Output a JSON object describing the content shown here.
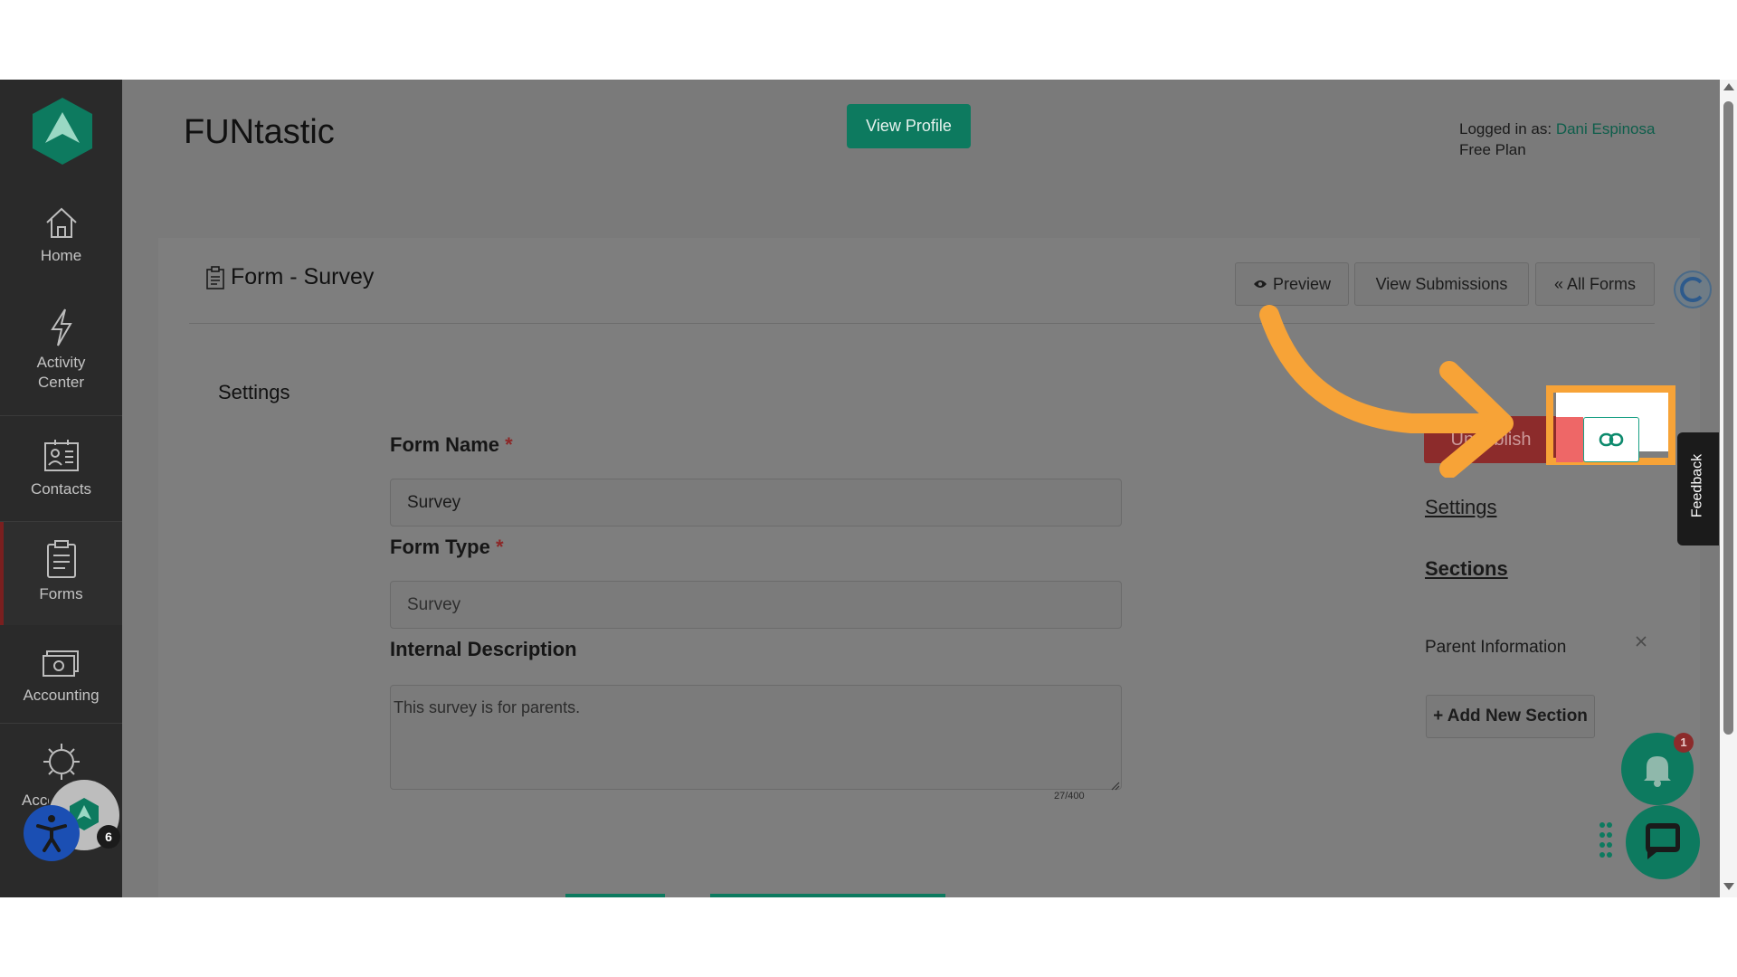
{
  "header": {
    "org_name": "FUNtastic",
    "view_profile_label": "View Profile",
    "logged_in_prefix": "Logged in as:",
    "user_name": "Dani Espinosa",
    "plan": "Free Plan"
  },
  "sidebar": {
    "items": [
      {
        "label": "Home",
        "icon": "home-icon"
      },
      {
        "label": "Activity Center",
        "icon": "lightning-icon"
      },
      {
        "label": "Contacts",
        "icon": "contacts-icon"
      },
      {
        "label": "Forms",
        "icon": "forms-icon"
      },
      {
        "label": "Accounting",
        "icon": "accounting-icon"
      },
      {
        "label": "Account Settings",
        "label_visible": "Acc S",
        "icon": "gear-icon"
      }
    ],
    "badge_count": "6"
  },
  "form_header": {
    "title": "Form - Survey",
    "preview_label": "Preview",
    "view_submissions_label": "View Submissions",
    "all_forms_label": "« All Forms"
  },
  "settings_heading": "Settings",
  "form_fields": {
    "form_name_label": "Form Name",
    "form_name_value": "Survey",
    "form_type_label": "Form Type",
    "form_type_value": "Survey",
    "internal_description_label": "Internal Description",
    "internal_description_value": "This survey is for parents.",
    "char_count": "27/400",
    "required_mark": "*"
  },
  "right_panel": {
    "unpublish_label": "Unpublish",
    "settings_link": "Settings",
    "sections_link": "Sections",
    "section_items": [
      "Parent Information"
    ],
    "add_section_label": "+ Add New Section"
  },
  "feedback_tab": "Feedback",
  "notification_count": "1",
  "colors": {
    "brand_green": "#0d7a5f",
    "highlight_orange": "#f7a337",
    "unpublish_red": "#8c2b2b",
    "link_teal": "#0e5e4b"
  }
}
